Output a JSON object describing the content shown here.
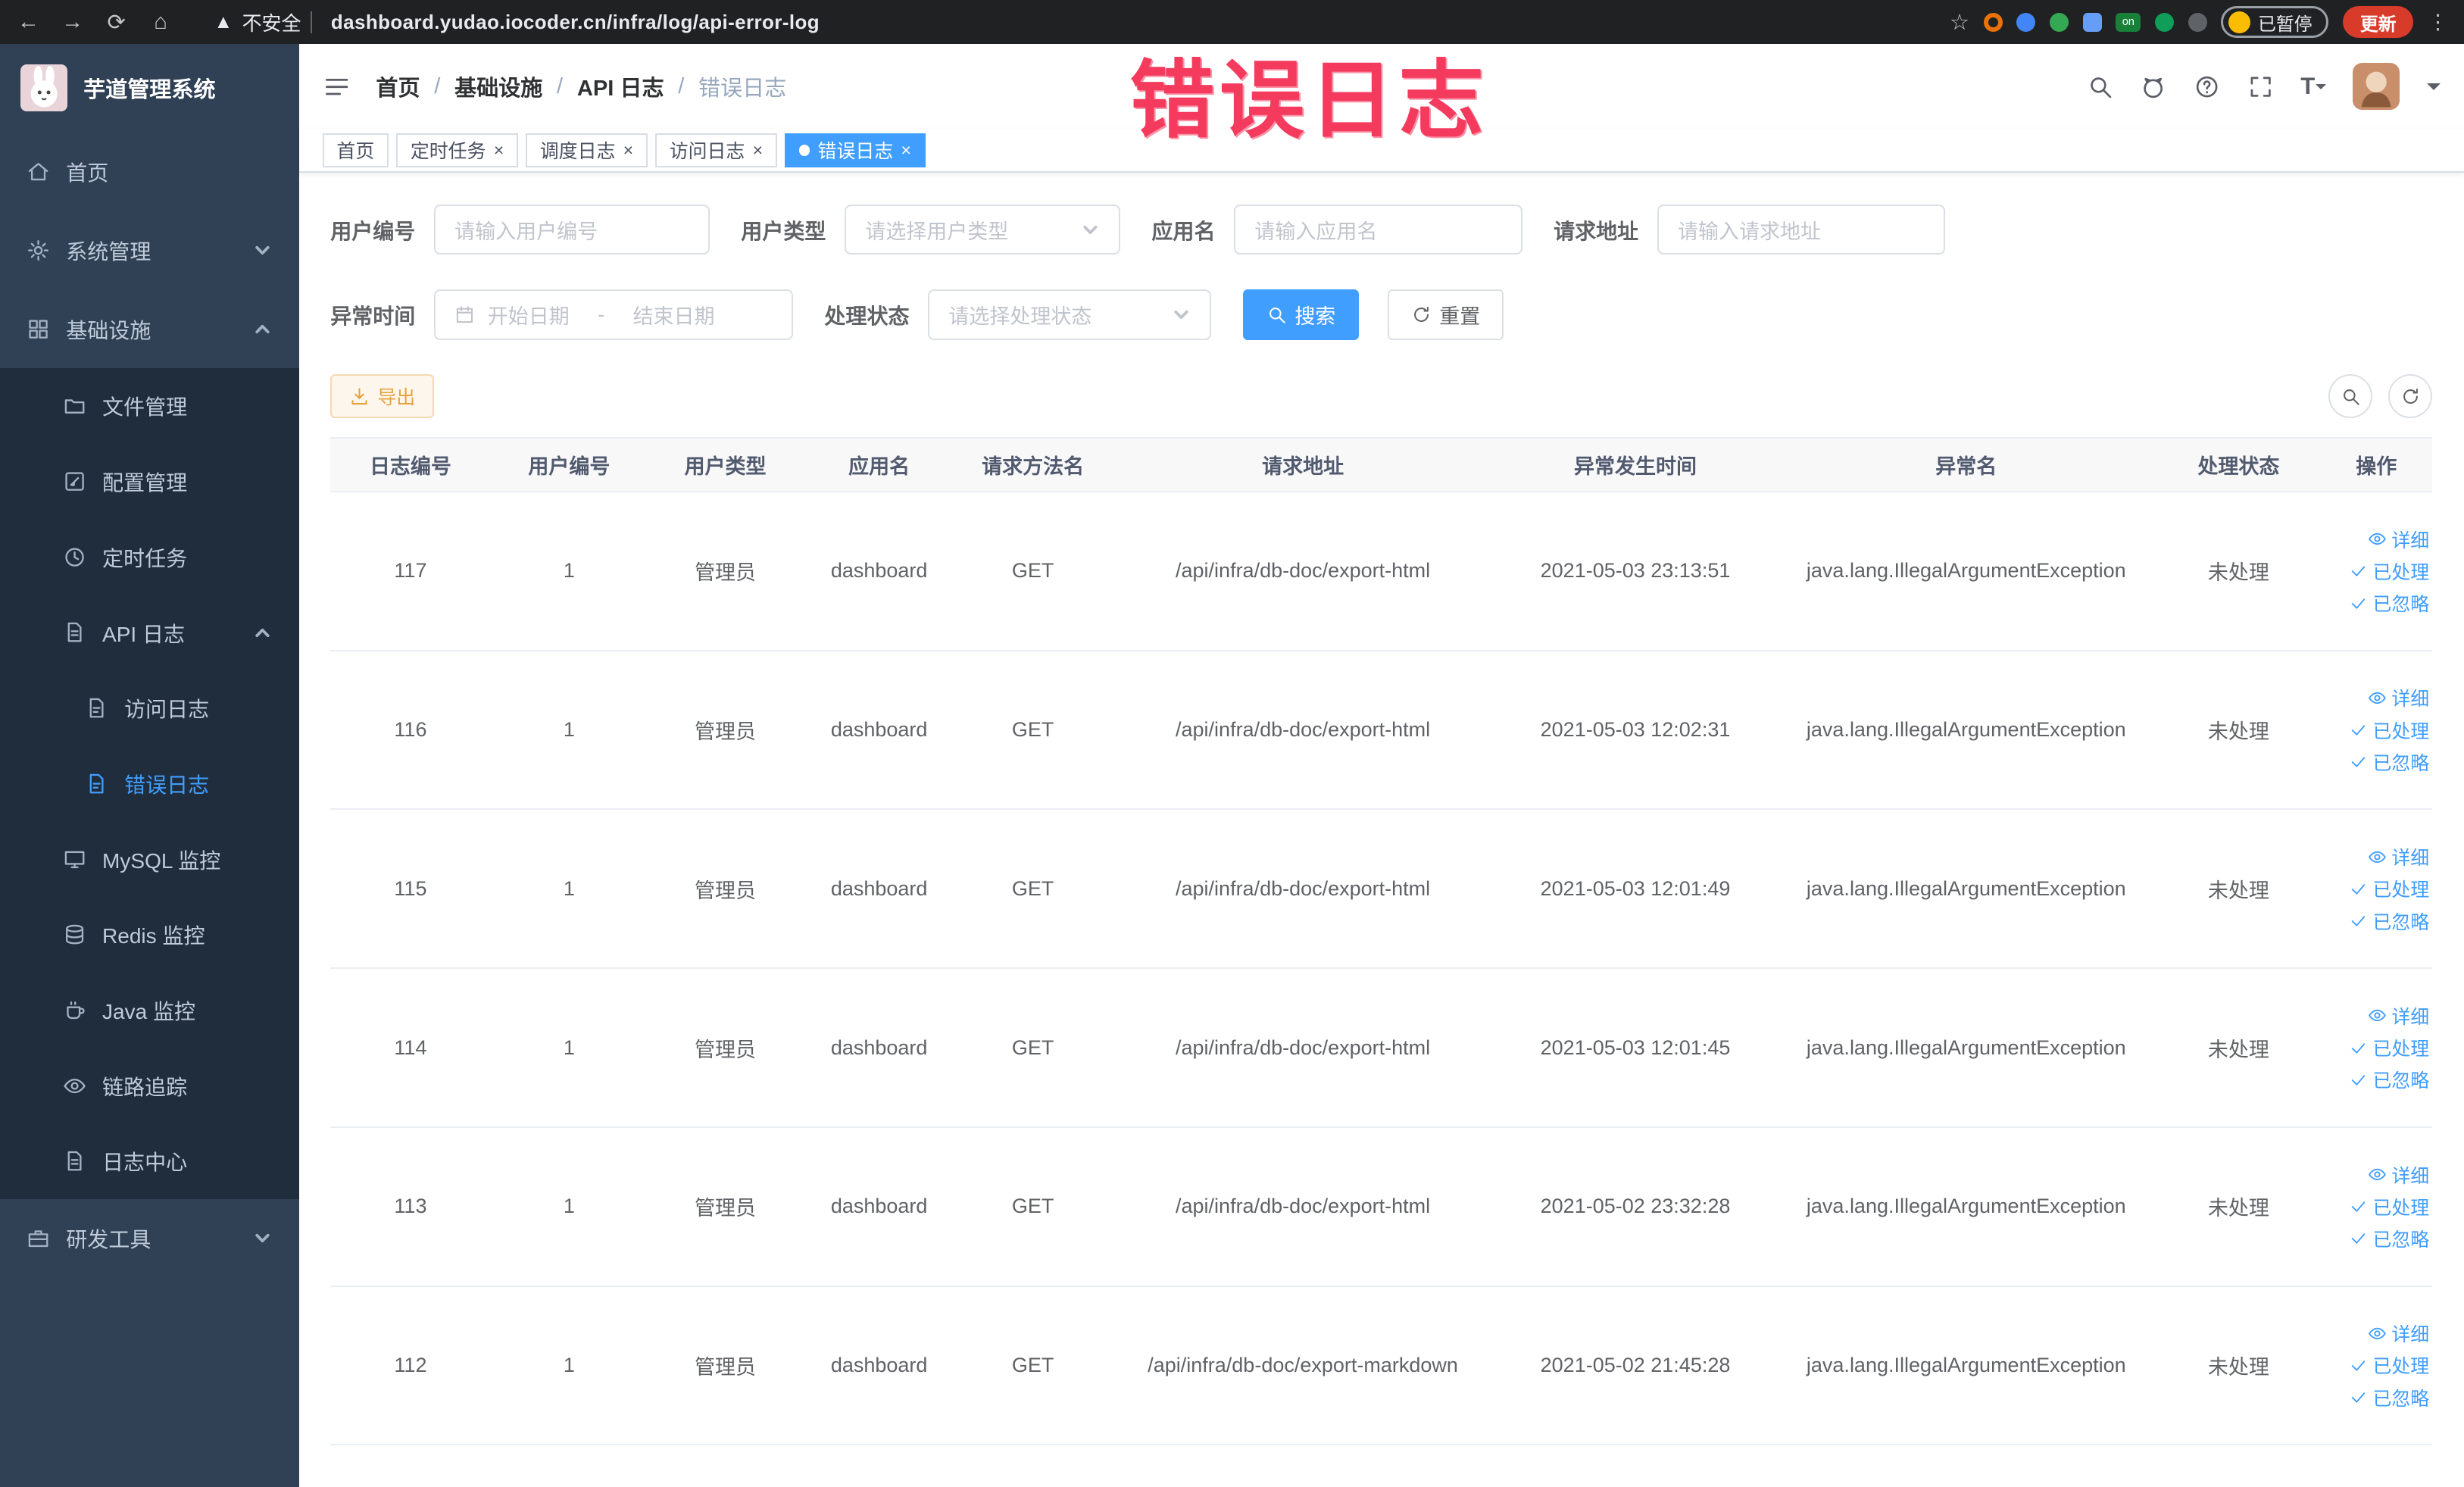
{
  "browser": {
    "security_label": "不安全",
    "url": "dashboard.yudao.iocoder.cn/infra/log/api-error-log",
    "paused_label": "已暂停",
    "update_label": "更新"
  },
  "annotation": {
    "text": "错误日志",
    "color": "#f43b5e"
  },
  "colors": {
    "primary": "#409eff",
    "warning": "#e6a23c",
    "sidebar": "#304156",
    "submenu": "#1f2d3d",
    "active_tab": "#409eff"
  },
  "sidebar": {
    "title": "芋道管理系统",
    "items": [
      {
        "name": "home",
        "icon": "home",
        "label": "首页",
        "depth": 0
      },
      {
        "name": "system-manage",
        "icon": "gear",
        "label": "系统管理",
        "depth": 0,
        "chevron": "down"
      },
      {
        "name": "infrastructure",
        "icon": "grid",
        "label": "基础设施",
        "depth": 0,
        "chevron": "up"
      },
      {
        "name": "file-manage",
        "icon": "folder",
        "label": "文件管理",
        "depth": 1
      },
      {
        "name": "config-manage",
        "icon": "edit",
        "label": "配置管理",
        "depth": 1
      },
      {
        "name": "scheduled-jobs",
        "icon": "clock",
        "label": "定时任务",
        "depth": 1
      },
      {
        "name": "api-log",
        "icon": "doc",
        "label": "API 日志",
        "depth": 1,
        "chevron": "up"
      },
      {
        "name": "access-log",
        "icon": "doc-edit",
        "label": "访问日志",
        "depth": 2
      },
      {
        "name": "error-log",
        "icon": "doc-edit",
        "label": "错误日志",
        "depth": 2,
        "active": true
      },
      {
        "name": "mysql-monitor",
        "icon": "monitor",
        "label": "MySQL 监控",
        "depth": 1
      },
      {
        "name": "redis-monitor",
        "icon": "database",
        "label": "Redis 监控",
        "depth": 1
      },
      {
        "name": "java-monitor",
        "icon": "coffee",
        "label": "Java 监控",
        "depth": 1
      },
      {
        "name": "link-trace",
        "icon": "eye",
        "label": "链路追踪",
        "depth": 1
      },
      {
        "name": "log-center",
        "icon": "doc",
        "label": "日志中心",
        "depth": 1
      },
      {
        "name": "dev-tools",
        "icon": "briefcase",
        "label": "研发工具",
        "depth": 0,
        "chevron": "down"
      }
    ]
  },
  "header": {
    "breadcrumb": [
      "首页",
      "基础设施",
      "API 日志",
      "错误日志"
    ]
  },
  "tabs": [
    {
      "label": "首页",
      "closable": false,
      "active": false
    },
    {
      "label": "定时任务",
      "closable": true,
      "active": false
    },
    {
      "label": "调度日志",
      "closable": true,
      "active": false
    },
    {
      "label": "访问日志",
      "closable": true,
      "active": false
    },
    {
      "label": "错误日志",
      "closable": true,
      "active": true
    }
  ],
  "filters": {
    "user_id": {
      "label": "用户编号",
      "placeholder": "请输入用户编号"
    },
    "user_type": {
      "label": "用户类型",
      "placeholder": "请选择用户类型"
    },
    "app_name": {
      "label": "应用名",
      "placeholder": "请输入应用名"
    },
    "request_url": {
      "label": "请求地址",
      "placeholder": "请输入请求地址"
    },
    "exception_time": {
      "label": "异常时间",
      "start_placeholder": "开始日期",
      "separator": "-",
      "end_placeholder": "结束日期"
    },
    "process_status": {
      "label": "处理状态",
      "placeholder": "请选择处理状态"
    },
    "search_label": "搜索",
    "reset_label": "重置"
  },
  "toolbar": {
    "export_label": "导出"
  },
  "table": {
    "headers": [
      "日志编号",
      "用户编号",
      "用户类型",
      "应用名",
      "请求方法名",
      "请求地址",
      "异常发生时间",
      "异常名",
      "处理状态",
      "操作"
    ],
    "rows": [
      [
        "117",
        "1",
        "管理员",
        "dashboard",
        "GET",
        "/api/infra/db-doc/export-html",
        "2021-05-03 23:13:51",
        "java.lang.IllegalArgumentException",
        "未处理"
      ],
      [
        "116",
        "1",
        "管理员",
        "dashboard",
        "GET",
        "/api/infra/db-doc/export-html",
        "2021-05-03 12:02:31",
        "java.lang.IllegalArgumentException",
        "未处理"
      ],
      [
        "115",
        "1",
        "管理员",
        "dashboard",
        "GET",
        "/api/infra/db-doc/export-html",
        "2021-05-03 12:01:49",
        "java.lang.IllegalArgumentException",
        "未处理"
      ],
      [
        "114",
        "1",
        "管理员",
        "dashboard",
        "GET",
        "/api/infra/db-doc/export-html",
        "2021-05-03 12:01:45",
        "java.lang.IllegalArgumentException",
        "未处理"
      ],
      [
        "113",
        "1",
        "管理员",
        "dashboard",
        "GET",
        "/api/infra/db-doc/export-html",
        "2021-05-02 23:32:28",
        "java.lang.IllegalArgumentException",
        "未处理"
      ],
      [
        "112",
        "1",
        "管理员",
        "dashboard",
        "GET",
        "/api/infra/db-doc/export-markdown",
        "2021-05-02 21:45:28",
        "java.lang.IllegalArgumentException",
        "未处理"
      ]
    ],
    "actions": [
      "详细",
      "已处理",
      "已忽略"
    ]
  }
}
